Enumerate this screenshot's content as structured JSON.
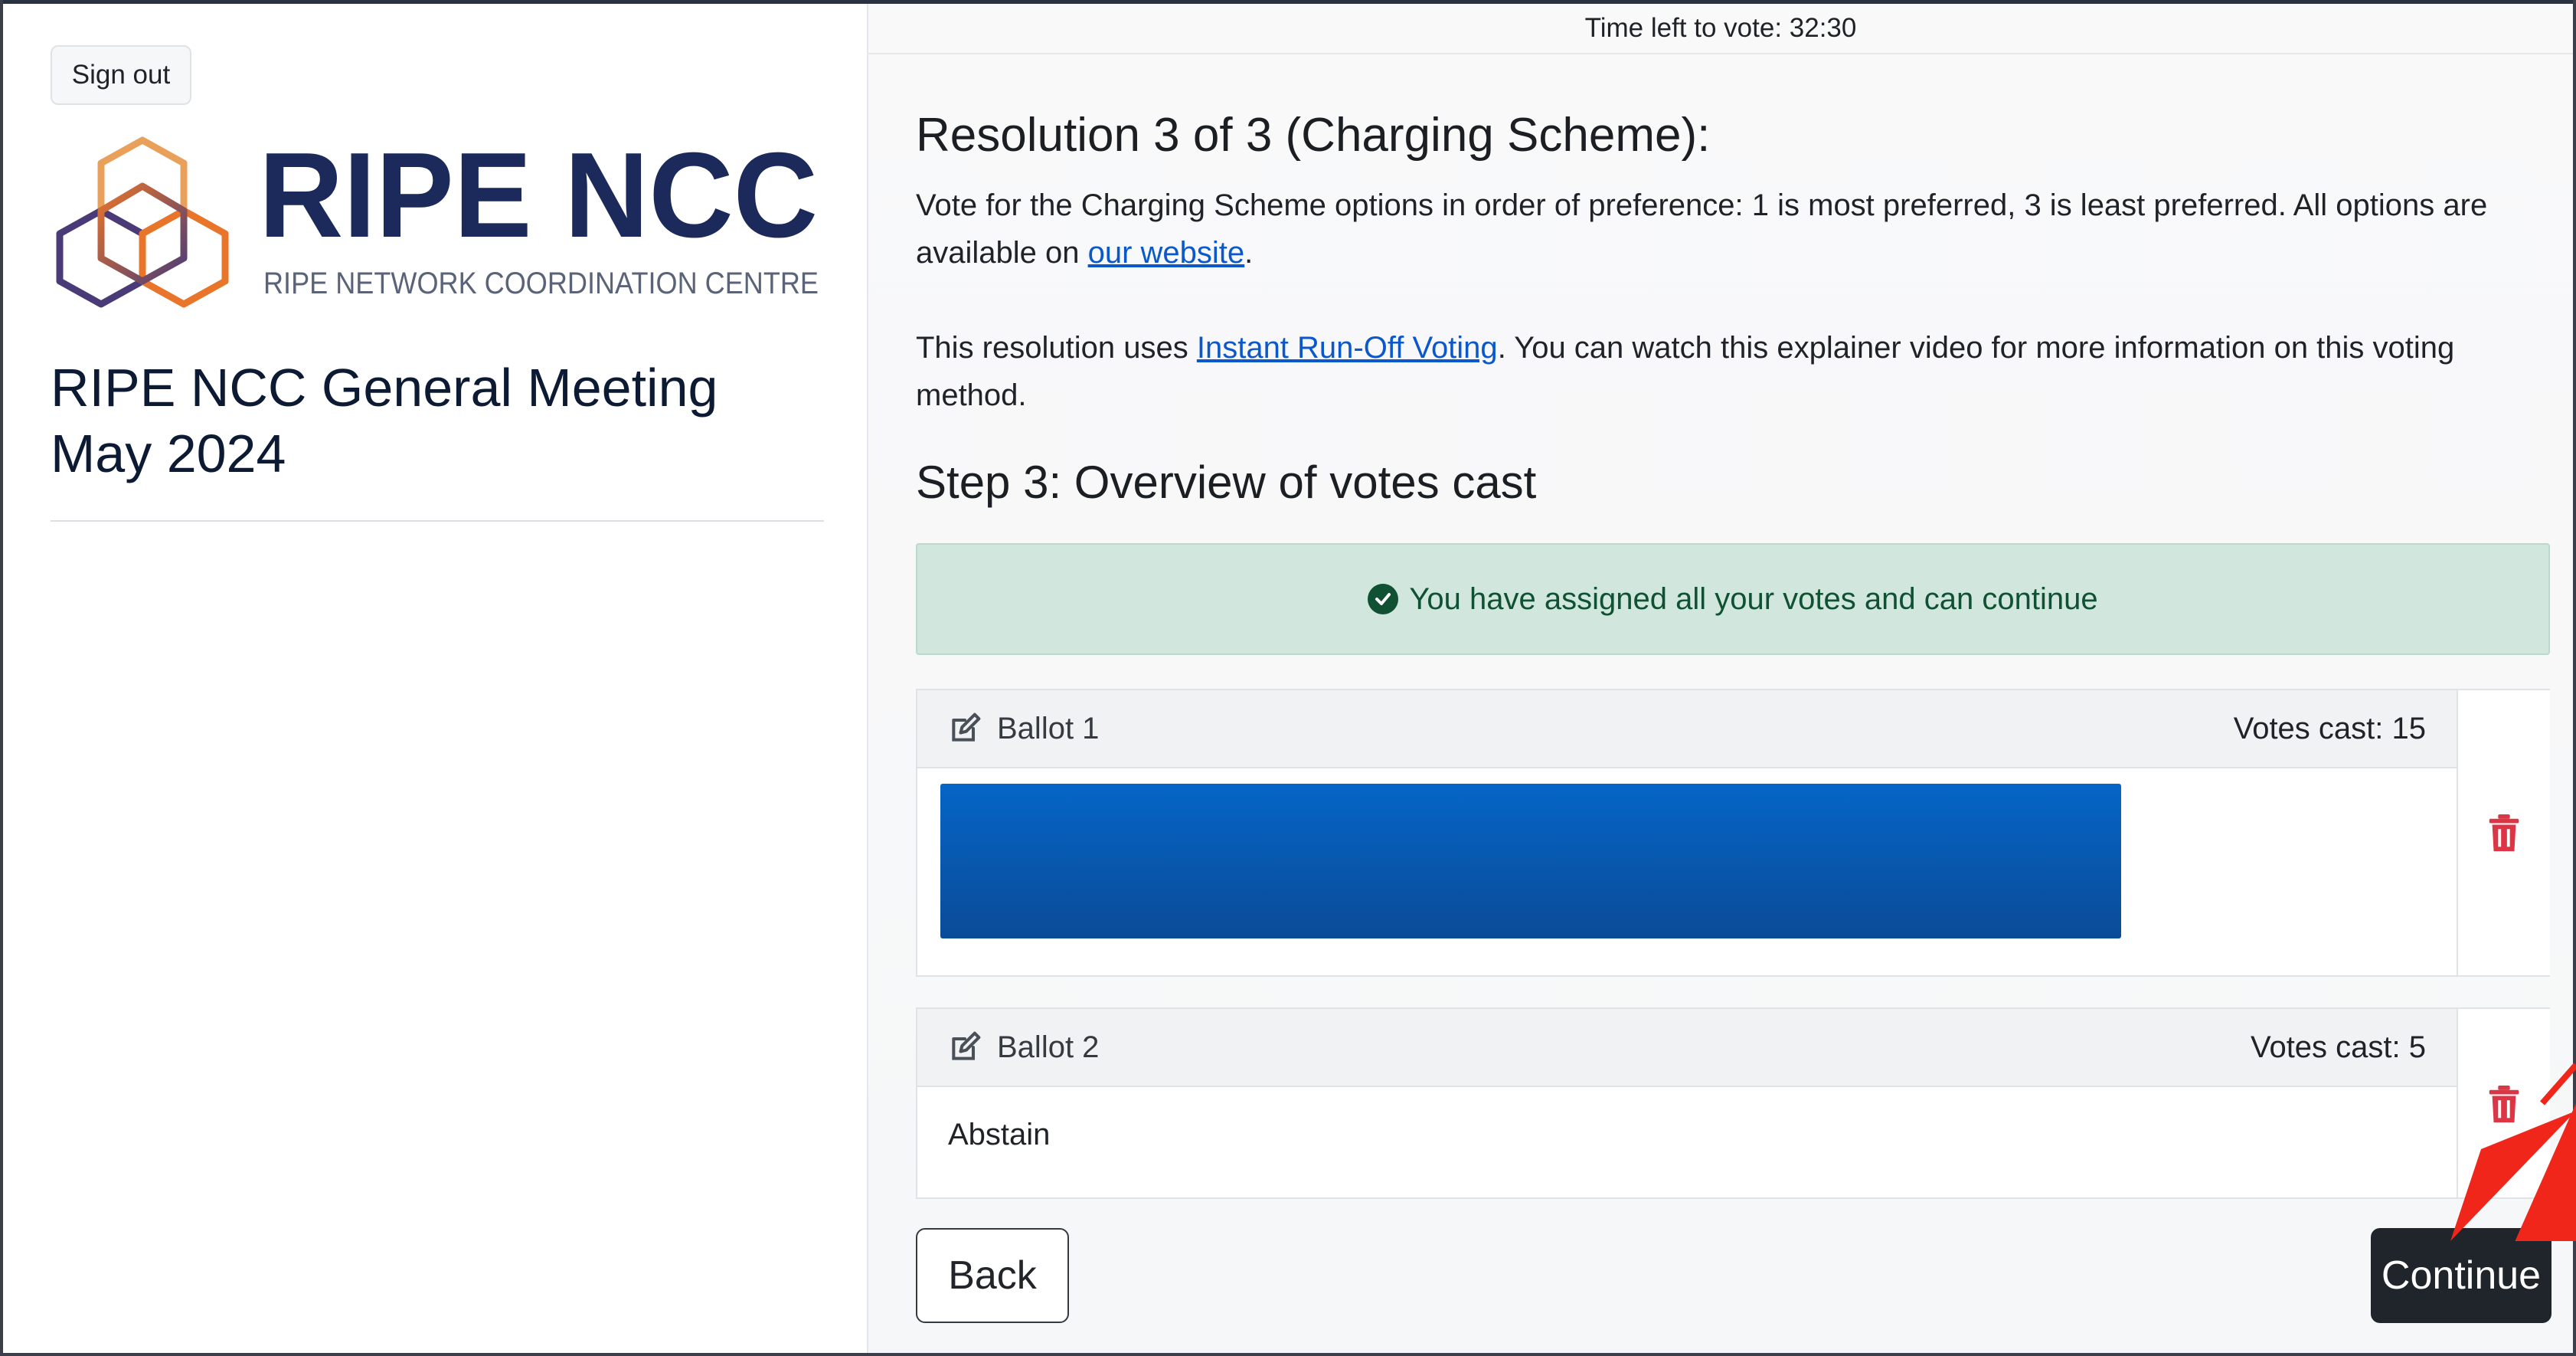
{
  "sidebar": {
    "signout_label": "Sign out",
    "logo": {
      "wordmark": "RIPE NCC",
      "tagline": "RIPE NETWORK COORDINATION CENTRE",
      "colors": {
        "text": "#1b2a5a",
        "orange": "#e8752a",
        "purple": "#4a3b78"
      }
    },
    "meeting_title": "RIPE NCC General Meeting May 2024"
  },
  "main": {
    "timer": "Time left to vote: 32:30",
    "resolution_title": "Resolution 3 of 3 (Charging Scheme):",
    "instructions": {
      "text": "Vote for the Charging Scheme options in order of preference: 1 is most preferred, 3 is least preferred. All options are available on ",
      "link_text": "our website",
      "suffix": "."
    },
    "voting_info": {
      "prefix": "This resolution uses ",
      "link_text": "Instant Run-Off Voting",
      "suffix": ". You can watch this explainer video for more information on this voting method."
    },
    "step_title": "Step 3: Overview of votes cast",
    "alert": {
      "icon": "check-circle-icon",
      "text": "You have assigned all your votes and can continue",
      "color": "#0f5132",
      "background": "#d1e7dd"
    },
    "ballots": [
      {
        "name": "Ballot 1",
        "votes": "Votes cast: 15",
        "content_color": "#0565c6"
      },
      {
        "name": "Ballot 2",
        "votes": "Votes cast: 5",
        "content": "Abstain"
      }
    ],
    "buttons": {
      "back": "Back",
      "continue": "Continue"
    },
    "accent_colors": {
      "link": "#0a58ca",
      "danger": "#dc3545",
      "dark_button": "#1f252b",
      "annotation_arrow": "#f0261b"
    }
  }
}
